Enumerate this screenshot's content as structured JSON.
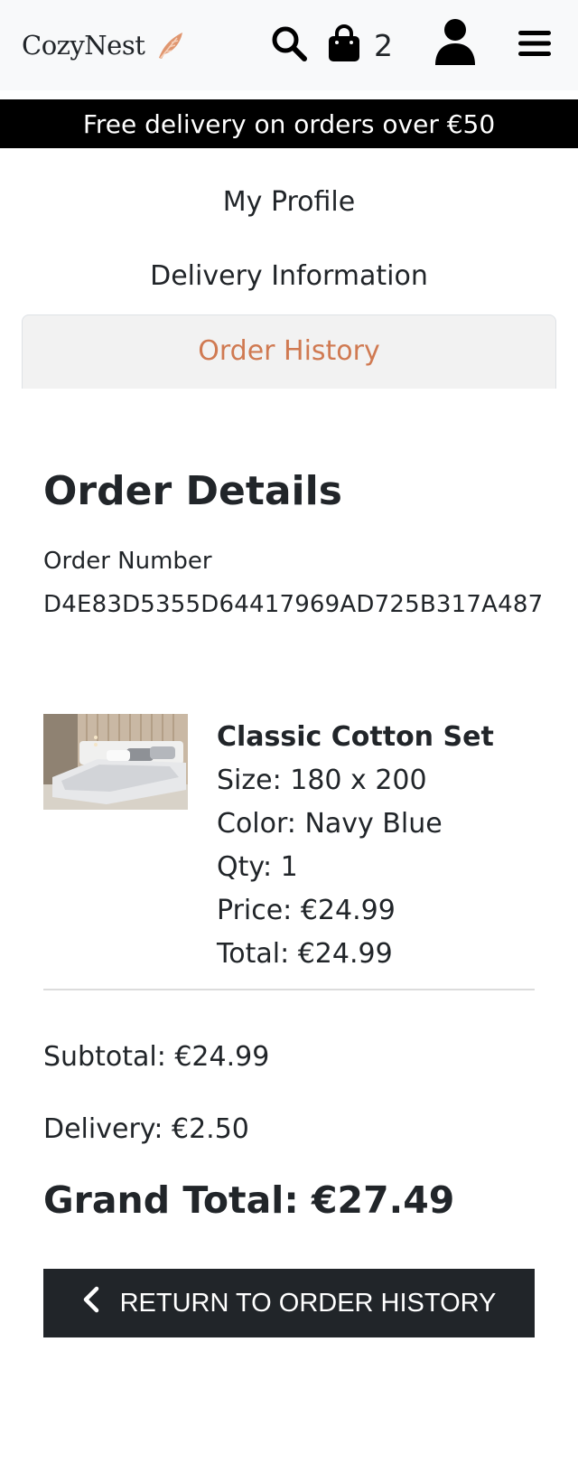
{
  "header": {
    "brand": "CozyNest",
    "cart_count": "2"
  },
  "banner": {
    "text": "Free delivery on orders over €50"
  },
  "nav": {
    "items": [
      {
        "label": "My Profile"
      },
      {
        "label": "Delivery Information"
      },
      {
        "label": "Order History"
      }
    ],
    "active_index": 2
  },
  "order": {
    "title": "Order Details",
    "number_label": "Order Number",
    "number": "D4E83D5355D64417969AD725B317A487",
    "item": {
      "name": "Classic Cotton Set",
      "size": "Size: 180 x 200",
      "color": "Color: Navy Blue",
      "qty": "Qty: 1",
      "price": "Price: €24.99",
      "total": "Total: €24.99"
    },
    "subtotal": "Subtotal: €24.99",
    "delivery": "Delivery: €2.50",
    "grand_total": "Grand Total: €27.49"
  },
  "actions": {
    "return_label": "RETURN TO ORDER HISTORY"
  },
  "colors": {
    "accent": "#d07a52",
    "dark": "#212529",
    "banner": "#000000"
  },
  "icons": {
    "brand": "feather-icon",
    "search": "search-icon",
    "bag": "shopping-bag-icon",
    "user": "user-icon",
    "menu": "hamburger-menu-icon",
    "back": "chevron-left-icon"
  }
}
